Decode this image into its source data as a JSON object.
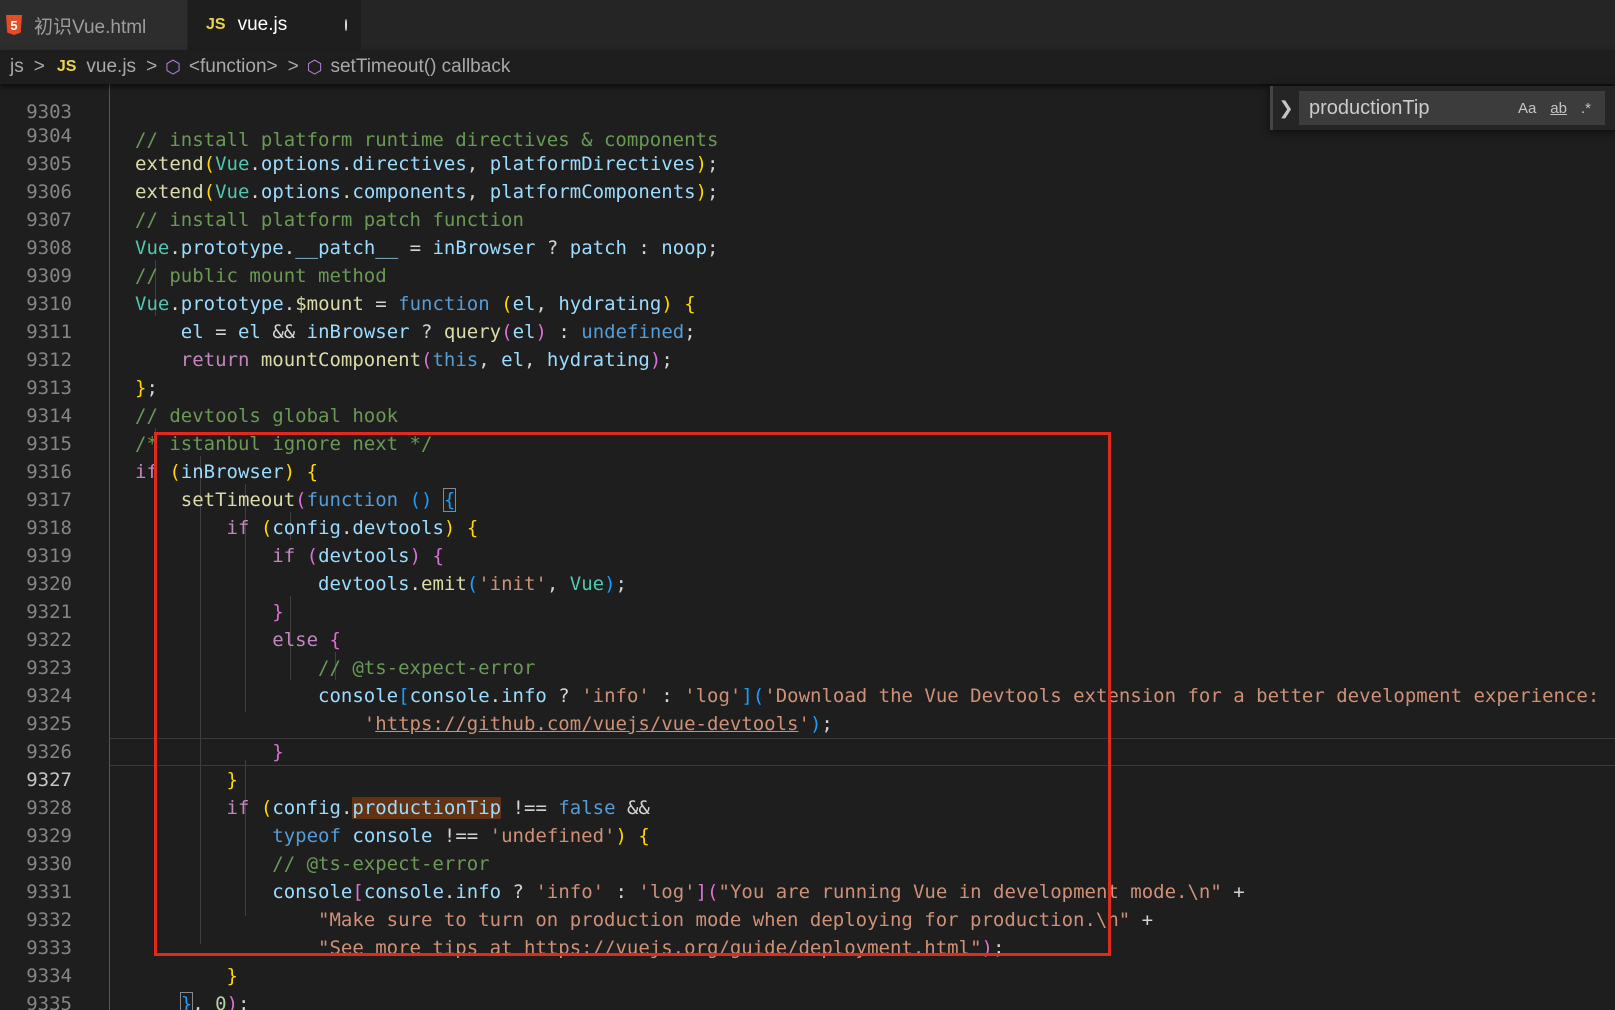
{
  "tabs": [
    {
      "icon": "5",
      "label": "初识Vue.html"
    },
    {
      "icon": "JS",
      "label": "vue.js"
    }
  ],
  "breadcrumb": {
    "folder": "js",
    "file_icon": "JS",
    "file": "vue.js",
    "item1": "<function>",
    "item2": "setTimeout() callback"
  },
  "find": {
    "value": "productionTip",
    "match_case": "Aa",
    "whole_word": "ab",
    "regex": ".*"
  },
  "lines": [
    "9303",
    "9304",
    "9305",
    "9306",
    "9307",
    "9308",
    "9309",
    "9310",
    "9311",
    "9312",
    "9313",
    "9314",
    "9315",
    "9316",
    "9317",
    "9318",
    "9319",
    "9320",
    "9321",
    "9322",
    "9323",
    "9324",
    "9325",
    "9326",
    "9327",
    "9328",
    "9329",
    "9330",
    "9331",
    "9332",
    "9333",
    "9334",
    "9335"
  ],
  "code": {
    "c9303": "// install platform runtime directives & components",
    "c9306": "// install platform patch function",
    "c9308": "// public mount method",
    "c9313": "// devtools global hook",
    "c9314": "/* istanbul ignore next */",
    "c9322": "// @ts-expect-error",
    "c9329": "// @ts-expect-error",
    "s9319": "'init'",
    "s9323": "'Download the Vue Devtools extension for a better development experience:",
    "url9324": "https://github.com/vuejs/vue-devtools",
    "s9330": "\"You are running Vue in development mode.\\n\"",
    "s9331": "\"Make sure to turn on production mode when deploying for production.\\n\"",
    "s9332a": "\"See more tips at ",
    "url9332": "https://vuejs.org/guide/deployment.html",
    "num9334": "0",
    "search_hit": "productionTip"
  },
  "colors": {
    "background": "#1e1e1e",
    "keyword": "#c586c0",
    "function": "#dcdcaa",
    "variable": "#9cdcfe",
    "comment": "#6a9955",
    "string": "#ce9178",
    "highlight_box": "#e02a1e"
  }
}
